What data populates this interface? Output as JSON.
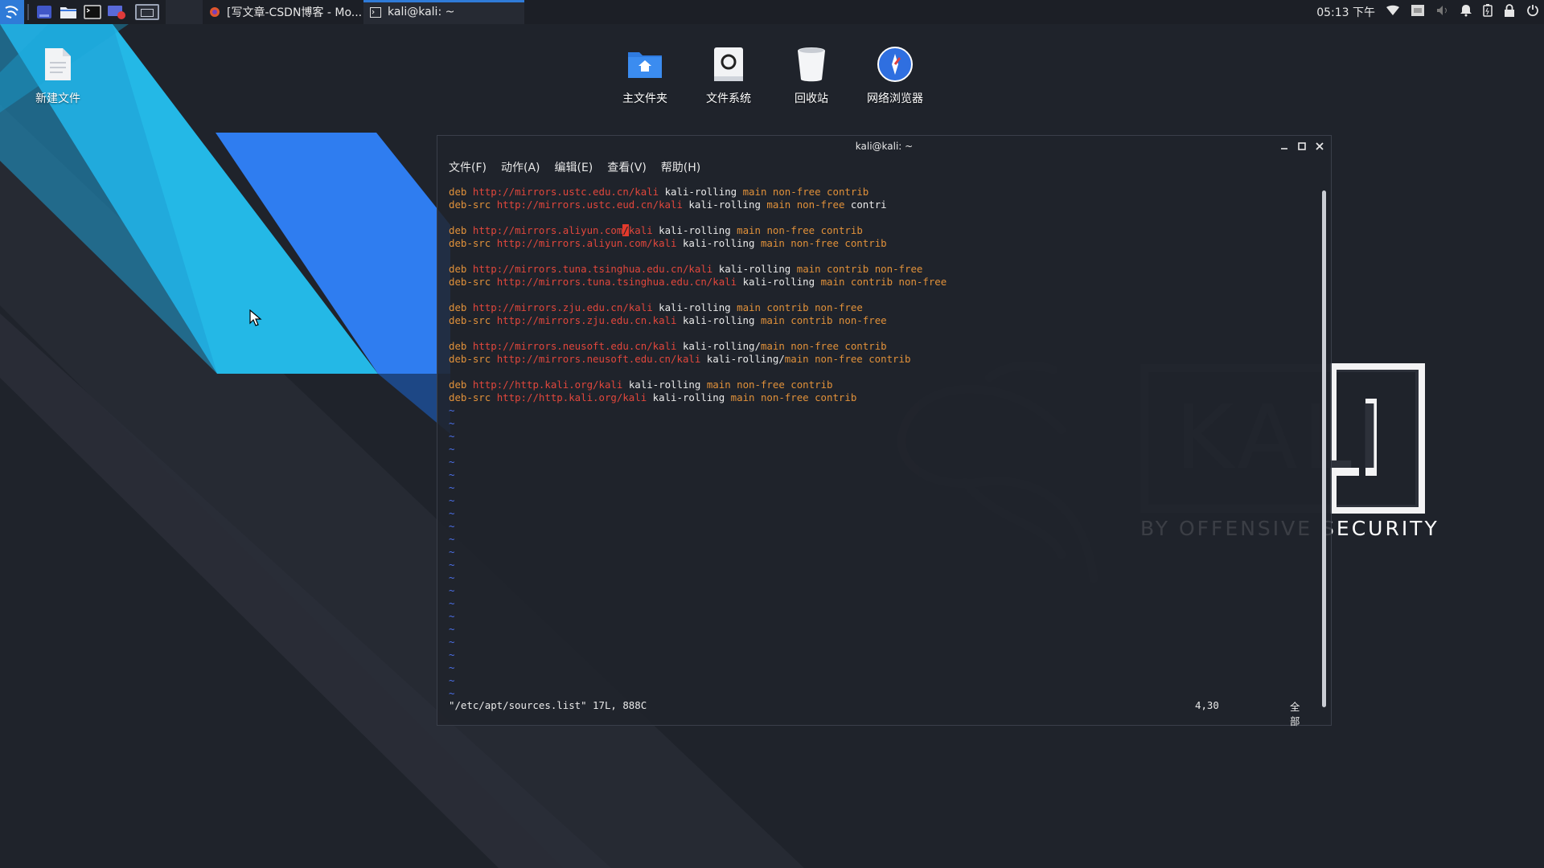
{
  "panel": {
    "tasks": [
      {
        "label": "[写文章-CSDN博客 - Mo...",
        "icon": "firefox-icon"
      },
      {
        "label": "kali@kali: ~",
        "icon": "terminal-icon",
        "active": true
      }
    ],
    "clock": "05:13 下午"
  },
  "desktop": {
    "icons": [
      {
        "label": "新建文件",
        "icon": "document-icon"
      },
      {
        "label": "主文件夹",
        "icon": "home-folder-icon"
      },
      {
        "label": "文件系统",
        "icon": "filesystem-icon"
      },
      {
        "label": "回收站",
        "icon": "trash-icon"
      },
      {
        "label": "网络浏览器",
        "icon": "web-browser-icon"
      }
    ],
    "wallpaper_text": {
      "brand": "KALI",
      "tagline": "BY OFFENSIVE SECURITY"
    }
  },
  "terminal": {
    "title": "kali@kali: ~",
    "menu": [
      "文件(F)",
      "动作(A)",
      "编辑(E)",
      "查看(V)",
      "帮助(H)"
    ],
    "lines": [
      {
        "t": "deb",
        "u": "http://mirrors.ustc.edu.cn/kali",
        "s": "kali-rolling",
        "c": "main non-free contrib"
      },
      {
        "t": "deb-src",
        "u": "http://mirrors.ustc.eud.cn/kali",
        "s": "kali-rolling",
        "c": "main non-free",
        "tail": "contri"
      },
      {},
      {
        "t": "deb",
        "u1": "http://mirrors.aliyun.com",
        "cur": "/",
        "u2": "kali",
        "s": "kali-rolling",
        "c": "main non-free contrib"
      },
      {
        "t": "deb-src",
        "u": "http://mirrors.aliyun.com/kali",
        "s": "kali-rolling",
        "c": "main non-free contrib"
      },
      {},
      {
        "t": "deb",
        "u": "http://mirrors.tuna.tsinghua.edu.cn/kali",
        "s": "kali-rolling",
        "c": "main contrib non-free"
      },
      {
        "t": "deb-src",
        "u": "http://mirrors.tuna.tsinghua.edu.cn/kali",
        "s": "kali-rolling",
        "c": "main contrib non-free"
      },
      {},
      {
        "t": "deb",
        "u": "http://mirrors.zju.edu.cn/kali",
        "s": "kali-rolling",
        "c": "main contrib non-free"
      },
      {
        "t": "deb-src",
        "u": "http://mirrors.zju.edu.cn.kali",
        "s": "kali-rolling",
        "c": "main contrib non-free"
      },
      {},
      {
        "t": "deb",
        "u": "http://mirrors.neusoft.edu.cn/kali",
        "s": "kali-rolling/",
        "c": "main non-free contrib"
      },
      {
        "t": "deb-src",
        "u": "http://mirrors.neusoft.edu.cn/kali",
        "s": "kali-rolling/",
        "c": "main non-free contrib"
      },
      {},
      {
        "t": "deb",
        "u": "http://http.kali.org/kali",
        "s": "kali-rolling",
        "c": "main non-free contrib"
      },
      {
        "t": "deb-src",
        "u": "http://http.kali.org/kali",
        "s": "kali-rolling",
        "c": "main non-free contrib"
      }
    ],
    "tilde": "~",
    "tilde_count": 23,
    "status": {
      "file": "\"/etc/apt/sources.list\" 17L, 888C",
      "position": "4,30",
      "scroll": "全部"
    }
  }
}
